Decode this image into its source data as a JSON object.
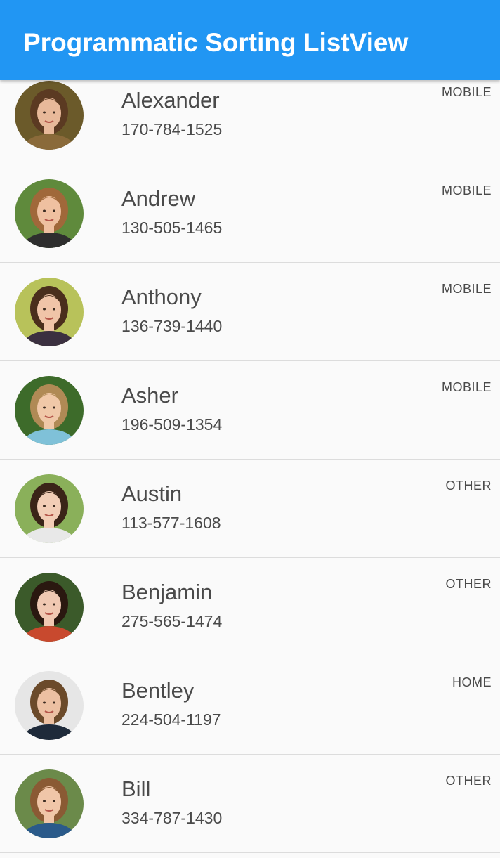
{
  "app": {
    "title": "Programmatic Sorting ListView",
    "accent": "#2196f3"
  },
  "contacts": [
    {
      "name": "Alexander",
      "phone": "170-784-1525",
      "type": "MOBILE",
      "avatar": {
        "bg": "#6b5a2a",
        "hair": "#5b3a22",
        "skin": "#e8b99a",
        "clothes": "#8a6a3a"
      }
    },
    {
      "name": "Andrew",
      "phone": "130-505-1465",
      "type": "MOBILE",
      "avatar": {
        "bg": "#5f8a3c",
        "hair": "#a0683a",
        "skin": "#efc0a0",
        "clothes": "#2e2e2e"
      }
    },
    {
      "name": "Anthony",
      "phone": "136-739-1440",
      "type": "MOBILE",
      "avatar": {
        "bg": "#b8c25a",
        "hair": "#4a2e1c",
        "skin": "#f0c4a8",
        "clothes": "#3b3040"
      }
    },
    {
      "name": "Asher",
      "phone": "196-509-1354",
      "type": "MOBILE",
      "avatar": {
        "bg": "#3d6b2a",
        "hair": "#b08a55",
        "skin": "#f0c8a8",
        "clothes": "#7fc1d8"
      }
    },
    {
      "name": "Austin",
      "phone": "113-577-1608",
      "type": "OTHER",
      "avatar": {
        "bg": "#8ab05a",
        "hair": "#3a2418",
        "skin": "#f2cdb6",
        "clothes": "#e8e8e8"
      }
    },
    {
      "name": "Benjamin",
      "phone": "275-565-1474",
      "type": "OTHER",
      "avatar": {
        "bg": "#3b5a2a",
        "hair": "#2a1810",
        "skin": "#f0c8b2",
        "clothes": "#c8492e"
      }
    },
    {
      "name": "Bentley",
      "phone": "224-504-1197",
      "type": "HOME",
      "avatar": {
        "bg": "#e6e6e6",
        "hair": "#6b4a2a",
        "skin": "#ecc0a2",
        "clothes": "#1e2a3a"
      }
    },
    {
      "name": "Bill",
      "phone": "334-787-1430",
      "type": "OTHER",
      "avatar": {
        "bg": "#6b8a4a",
        "hair": "#8a5a34",
        "skin": "#f0c6a8",
        "clothes": "#2a5a8a"
      }
    }
  ]
}
